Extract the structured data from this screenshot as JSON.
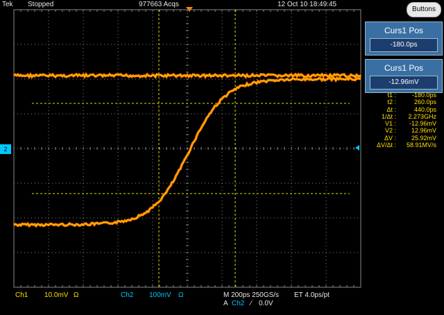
{
  "topbar": {
    "brand": "Tek",
    "status": "Stopped",
    "acqs": "977663 Acqs",
    "datetime": "12 Oct 10 18:49:45",
    "buttons_label": "Buttons"
  },
  "channel_marker": "2",
  "panels": [
    {
      "title": "Curs1 Pos",
      "value": "-180.0ps"
    },
    {
      "title": "Curs1 Pos",
      "value": "-12.96mV"
    }
  ],
  "readout": [
    {
      "label": "t1 :",
      "value": "-180.0ps"
    },
    {
      "label": "t2 :",
      "value": "260.0ps"
    },
    {
      "label": "Δt :",
      "value": "440.0ps"
    },
    {
      "label": "1/Δt :",
      "value": "2.273GHz"
    },
    {
      "label": "V1 :",
      "value": "-12.96mV"
    },
    {
      "label": "V2 :",
      "value": "12.96mV"
    },
    {
      "label": "ΔV :",
      "value": "25.92mV"
    },
    {
      "label": "ΔV/Δt :",
      "value": "58.91MV/s"
    }
  ],
  "bottom": {
    "ch1_label": "Ch1",
    "ch1_scale": "10.0mV",
    "ch1_coupling": "Ω",
    "ch2_label": "Ch2",
    "ch2_scale": "100mV",
    "ch2_coupling": "Ω",
    "timebase": "M 200ps 250GS/s",
    "et": "ET 4.0ps/pt",
    "trigger_prefix": "A",
    "trigger_source": "Ch2",
    "trigger_slope": "∕",
    "trigger_level": "0.0V"
  },
  "colors": {
    "trace_orange": "#ff8000",
    "trace_yellow": "#ffd000",
    "cursor": "#e8e000",
    "grid": "#8a8a8a",
    "panel": "#3a6fa3",
    "ch2_cyan": "#00c8ff",
    "readout_yellow": "#ffe000"
  }
}
